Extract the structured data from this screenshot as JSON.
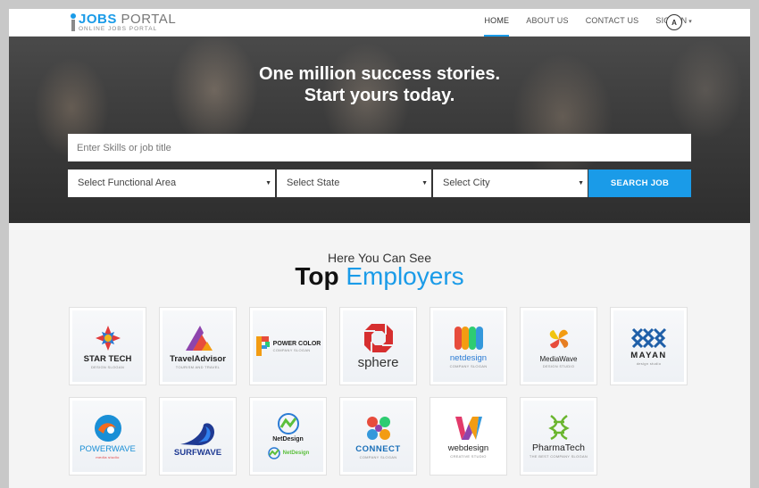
{
  "logo": {
    "brand": "JOBS",
    "brand_rest": " PORTAL",
    "tagline": "ONLINE JOBS PORTAL"
  },
  "nav": {
    "items": [
      {
        "label": "HOME"
      },
      {
        "label": "ABOUT US"
      },
      {
        "label": "CONTACT US"
      },
      {
        "label": "SIGN IN"
      }
    ],
    "language_icon": "A"
  },
  "hero": {
    "title_line1": "One million success stories.",
    "title_line2": "Start yours today.",
    "skills_placeholder": "Enter Skills or job title",
    "functional_area": "Select Functional Area",
    "state": "Select State",
    "city": "Select City",
    "search_button": "SEARCH JOB"
  },
  "employers": {
    "subtitle": "Here You Can See",
    "title_dark": "Top",
    "title_blue": "Employers",
    "logos": [
      {
        "name": "STAR TECH",
        "tag": "DESIGN SLOGAN",
        "icon": "star-tech-icon"
      },
      {
        "name": "TravelAdvisor",
        "tag": "TOURISM AND TRAVEL",
        "icon": "travel-advisor-icon"
      },
      {
        "name": "POWER COLOR",
        "tag": "COMPANY SLOGAN",
        "icon": "power-color-icon"
      },
      {
        "name": "sphere",
        "tag": "",
        "icon": "sphere-icon"
      },
      {
        "name": "netdesign",
        "tag": "COMPANY SLOGAN",
        "icon": "netdesign-icon"
      },
      {
        "name": "MediaWave",
        "tag": "DESIGN STUDIO",
        "icon": "media-wave-icon"
      },
      {
        "name": "MAYAN",
        "tag": "design studio",
        "icon": "mayan-icon"
      },
      {
        "name": "POWERWAVE",
        "tag": "media studio",
        "icon": "power-wave-icon"
      },
      {
        "name": "SURFWAVE",
        "tag": "",
        "icon": "surf-wave-icon"
      },
      {
        "name": "NetDesign",
        "tag": "NetDesign",
        "icon": "net-design-icon"
      },
      {
        "name": "CONNECT",
        "tag": "COMPANY SLOGAN",
        "icon": "connect-icon"
      },
      {
        "name": "webdesign",
        "tag": "CREATIVE STUDIO",
        "icon": "web-design-icon"
      },
      {
        "name": "PharmaTech",
        "tag": "THE BEST COMPANY SLOGAN",
        "icon": "pharma-tech-icon"
      }
    ]
  },
  "colors": {
    "accent": "#1a9be8",
    "hero_text": "#ffffff",
    "title_dark": "#111111"
  }
}
